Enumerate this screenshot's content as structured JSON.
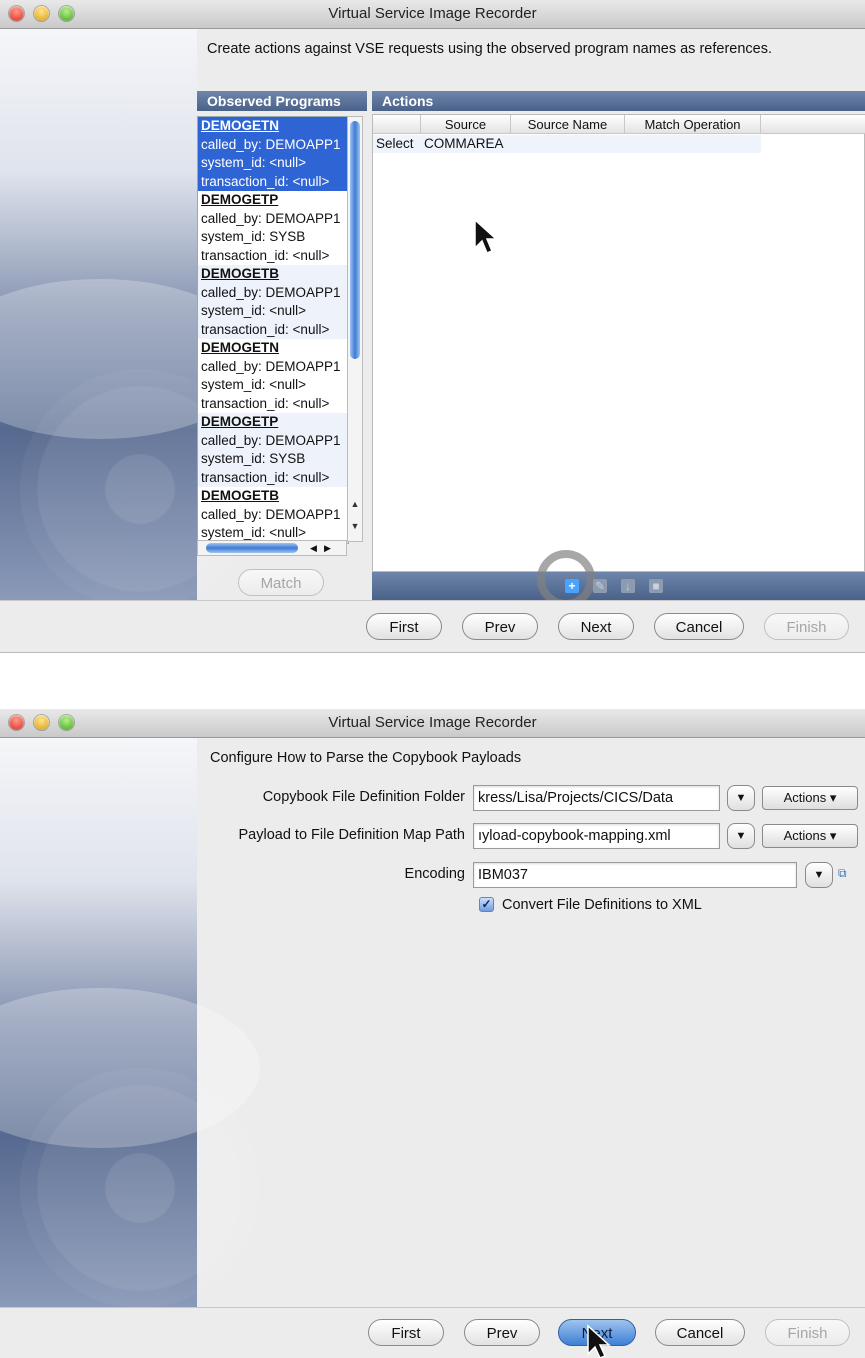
{
  "window1": {
    "title": "Virtual Service Image Recorder",
    "instructions": "Create actions against VSE requests using the observed program names as references.",
    "observed_header": "Observed Programs",
    "actions_header": "Actions",
    "programs": [
      {
        "name": "DEMOGETN",
        "called_by": "called_by: DEMOAPP1",
        "system_id": "system_id: <null>",
        "transaction_id": "transaction_id: <null>",
        "selected": true
      },
      {
        "name": "DEMOGETP",
        "called_by": "called_by: DEMOAPP1",
        "system_id": "system_id: SYSB",
        "transaction_id": "transaction_id: <null>"
      },
      {
        "name": "DEMOGETB",
        "called_by": "called_by: DEMOAPP1",
        "system_id": "system_id: <null>",
        "transaction_id": "transaction_id: <null>"
      },
      {
        "name": "DEMOGETN",
        "called_by": "called_by: DEMOAPP1",
        "system_id": "system_id: <null>",
        "transaction_id": "transaction_id: <null>"
      },
      {
        "name": "DEMOGETP",
        "called_by": "called_by: DEMOAPP1",
        "system_id": "system_id: SYSB",
        "transaction_id": "transaction_id: <null>"
      },
      {
        "name": "DEMOGETB",
        "called_by": "called_by: DEMOAPP1",
        "system_id": "system_id: <null>",
        "transaction_id": ""
      }
    ],
    "table": {
      "columns": [
        "",
        "Source",
        "Source Name",
        "Match Operation"
      ],
      "rows": [
        [
          "Select",
          "COMMAREA",
          "",
          ""
        ]
      ]
    },
    "match_label": "Match",
    "toolbar_icons": [
      "add-icon",
      "edit-icon",
      "move-down-icon",
      "delete-icon"
    ],
    "buttons": {
      "first": "First",
      "prev": "Prev",
      "next": "Next",
      "cancel": "Cancel",
      "finish": "Finish"
    }
  },
  "window2": {
    "title": "Virtual Service Image Recorder",
    "heading": "Configure How to Parse the Copybook Payloads",
    "copybook_label": "Copybook File Definition Folder",
    "copybook_value": "kress/Lisa/Projects/CICS/Data",
    "payload_label": "Payload to File Definition Map Path",
    "payload_value": "ıyload-copybook-mapping.xml",
    "encoding_label": "Encoding",
    "encoding_value": "IBM037",
    "actions_label": "Actions",
    "convert_label": "Convert File Definitions to XML",
    "convert_checked": true,
    "buttons": {
      "first": "First",
      "prev": "Prev",
      "next": "Next",
      "cancel": "Cancel",
      "finish": "Finish"
    }
  }
}
